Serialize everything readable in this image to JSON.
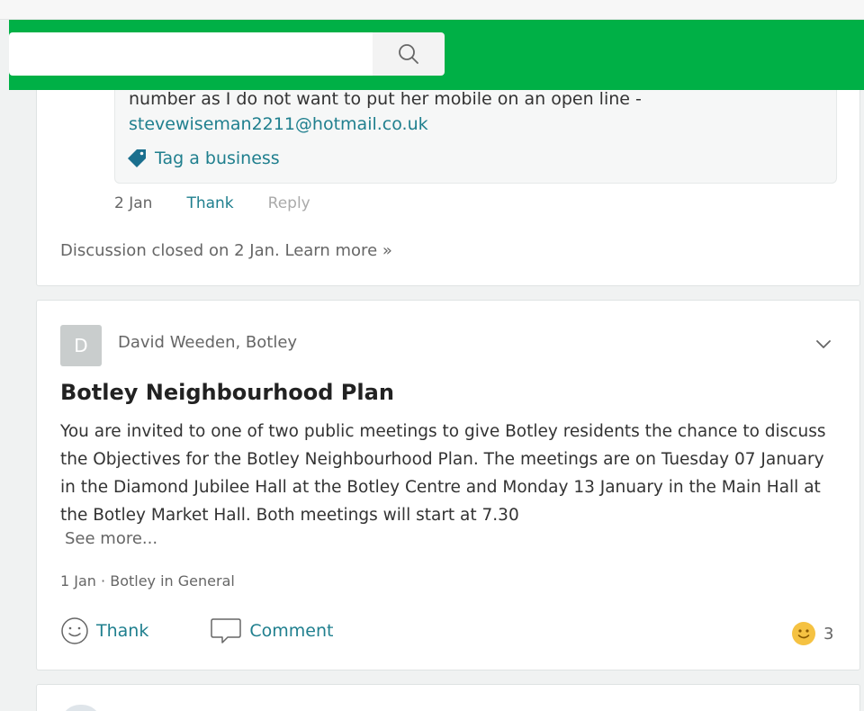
{
  "header": {
    "search": {
      "value": "",
      "placeholder": ""
    }
  },
  "reply": {
    "text": "number as I do not want to put her mobile on an open line -",
    "email": "stevewiseman2211@hotmail.co.uk",
    "tag_label": "Tag a business",
    "date": "2 Jan",
    "thank_label": "Thank",
    "reply_label": "Reply",
    "closed_text": "Discussion closed on 2 Jan.",
    "learn_more_label": "Learn more »"
  },
  "post": {
    "avatar_letter": "D",
    "author": "David Weeden, Botley",
    "title": "Botley Neighbourhood Plan",
    "body": "You are invited to one of two public meetings to give Botley residents the chance to discuss the Objectives for the Botley Neighbourhood Plan. The meetings are on Tuesday 07 January in the Diamond Jubilee Hall at the Botley Centre and Monday 13 January in the Main Hall at the Botley Market Hall. Both meetings will start at 7.30",
    "see_more_label": "See more...",
    "date": "1 Jan",
    "separator": "·",
    "group": "Botley in General",
    "thank_label": "Thank",
    "comment_label": "Comment",
    "reaction_count": "3"
  },
  "colors": {
    "brand_green": "#00b046",
    "link_teal": "#1f7f8e",
    "tag_icon": "#1a6f8e",
    "smiley_yellow": "#f5c242"
  },
  "icons": [
    "search-icon",
    "tag-icon",
    "chevron-down-icon",
    "smiley-icon",
    "comment-icon",
    "reaction-smiley-icon"
  ]
}
